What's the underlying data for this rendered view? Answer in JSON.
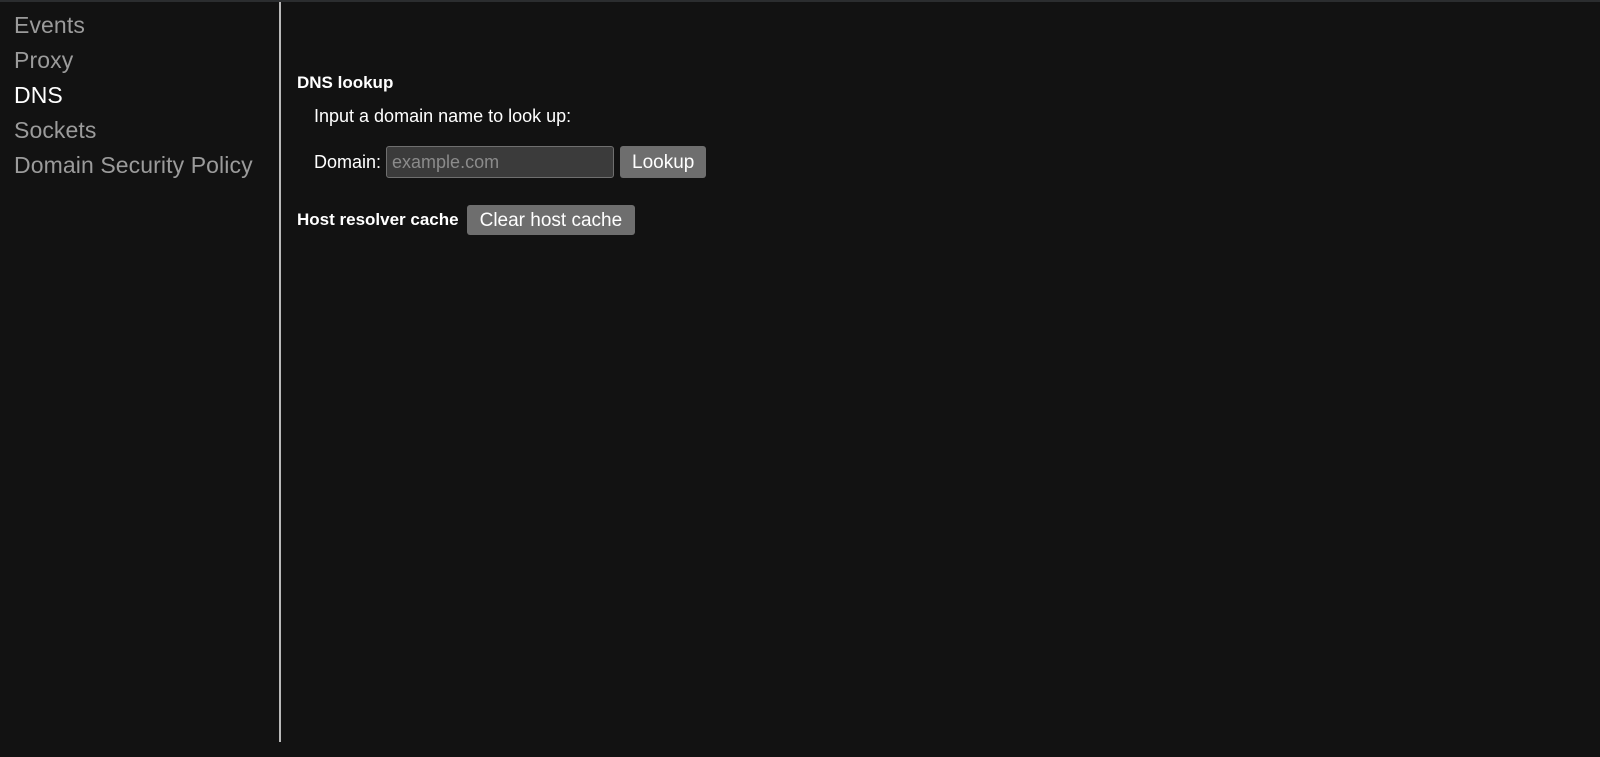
{
  "sidebar": {
    "items": [
      {
        "label": "Events",
        "selected": false
      },
      {
        "label": "Proxy",
        "selected": false
      },
      {
        "label": "DNS",
        "selected": true
      },
      {
        "label": "Sockets",
        "selected": false
      },
      {
        "label": "Domain Security Policy",
        "selected": false
      }
    ]
  },
  "main": {
    "dns_lookup": {
      "title": "DNS lookup",
      "instruction": "Input a domain name to look up:",
      "domain_label": "Domain:",
      "domain_value": "",
      "domain_placeholder": "example.com",
      "lookup_button": "Lookup"
    },
    "host_resolver_cache": {
      "label": "Host resolver cache",
      "clear_button": "Clear host cache"
    }
  },
  "colors": {
    "background": "#121212",
    "sidebar_text": "#9b9b9b",
    "sidebar_text_selected": "#ffffff",
    "divider": "#b9b9b9",
    "button_face": "#6e6e6e",
    "input_background": "#3b3b3b",
    "input_border": "#6f6f6f",
    "placeholder_text": "#8b8b8b"
  }
}
